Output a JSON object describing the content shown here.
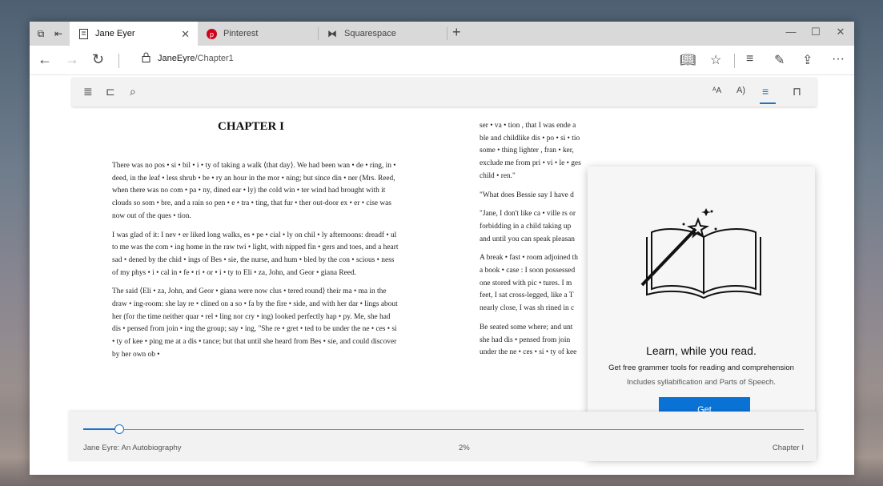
{
  "tabs": [
    {
      "title": "Jane Eyer",
      "icon": "document-icon",
      "active": true
    },
    {
      "title": "Pinterest",
      "icon": "pinterest-icon",
      "active": false
    },
    {
      "title": "Squarespace",
      "icon": "squarespace-icon",
      "active": false
    }
  ],
  "address": {
    "host": "JaneEyre",
    "path": "/Chapter1"
  },
  "book": {
    "chapter_heading": "CHAPTER I",
    "left_paragraphs": [
      "There was no pos • si • bil • i • ty of taking a walk ⟨that day⟩. We had been wan • de • ring, in • deed, in the leaf • less shrub • be • ry an hour in the mor • ning; but since din • ner (Mrs. Reed, when there was no com • pa • ny, dined ear • ly) the cold win • ter wind had brought with it clouds so som • bre, and a rain so pen • e • tra • ting, that fur • ther out-door ex • er • cise was now out of the ques • tion.",
      "I was glad of it: I nev • er liked long walks, es • pe • cial • ly on chil • ly afternoons: dreadf • ul to me was the com • ing home in the raw twi • light, with nipped fin • gers and toes, and a heart sad • dened by the chid • ings of Bes • sie, the nurse, and hum • bled by the con • scious • ness of my phys • i • cal in • fe • ri • or • i • ty to Eli • za, John, and Geor • giana Reed.",
      "The said ⟨Eli • za, John, and Geor • giana were now clus • tered round⟩ their ma • ma in the draw • ing-room: she lay re • clined on a so • fa by the fire • side, and with her dar • lings about her (for the time neither quar • rel • ling nor cry • ing) looked perfectly hap • py. Me, she had dis • pensed from join • ing the group; say • ing, \"She re • gret • ted to be under the ne • ces • si • ty of kee • ping me at a dis • tance; but that until she heard from Bes • sie, and could discover by her own ob •"
    ],
    "right_lines": [
      "ser • va • tion , that I  was ende a",
      "ble and childlike dis • po • si • tio",
      "some • thing lighter , fran • ker,",
      "exclude me  from  pri • vi • le • ges",
      "child • ren.\"",
      "",
      "\"What does  Bessie  say I  have d",
      "",
      "\"Jane, I  don't like  ca • ville rs or",
      "forbidding in a  child  taking up",
      "and until you can  speak pleasan",
      "",
      "A break • fast • room  adjoined th",
      "a book • case : I soon  possessed",
      "one stored with  pic • tures. I  m",
      "feet, I sat cross-legged, like a T",
      "nearly close, I  was sh rined in  c",
      "",
      "Be seated some where; and unt",
      "she had dis • pensed  from  join",
      "under the  ne • ces • si • ty of  kee"
    ]
  },
  "popup": {
    "title": "Learn, while you read.",
    "subtitle": "Get free grammer tools for reading and comprehension",
    "detail": "Includes syllabification and Parts of Speech.",
    "button": "Get"
  },
  "footer": {
    "book_title": "Jane Eyre: An Autobiography",
    "percent": "2%",
    "chapter": "Chapter I",
    "progress_fraction": 0.02
  },
  "colors": {
    "accent": "#1e73c8",
    "button": "#0a72d4"
  }
}
